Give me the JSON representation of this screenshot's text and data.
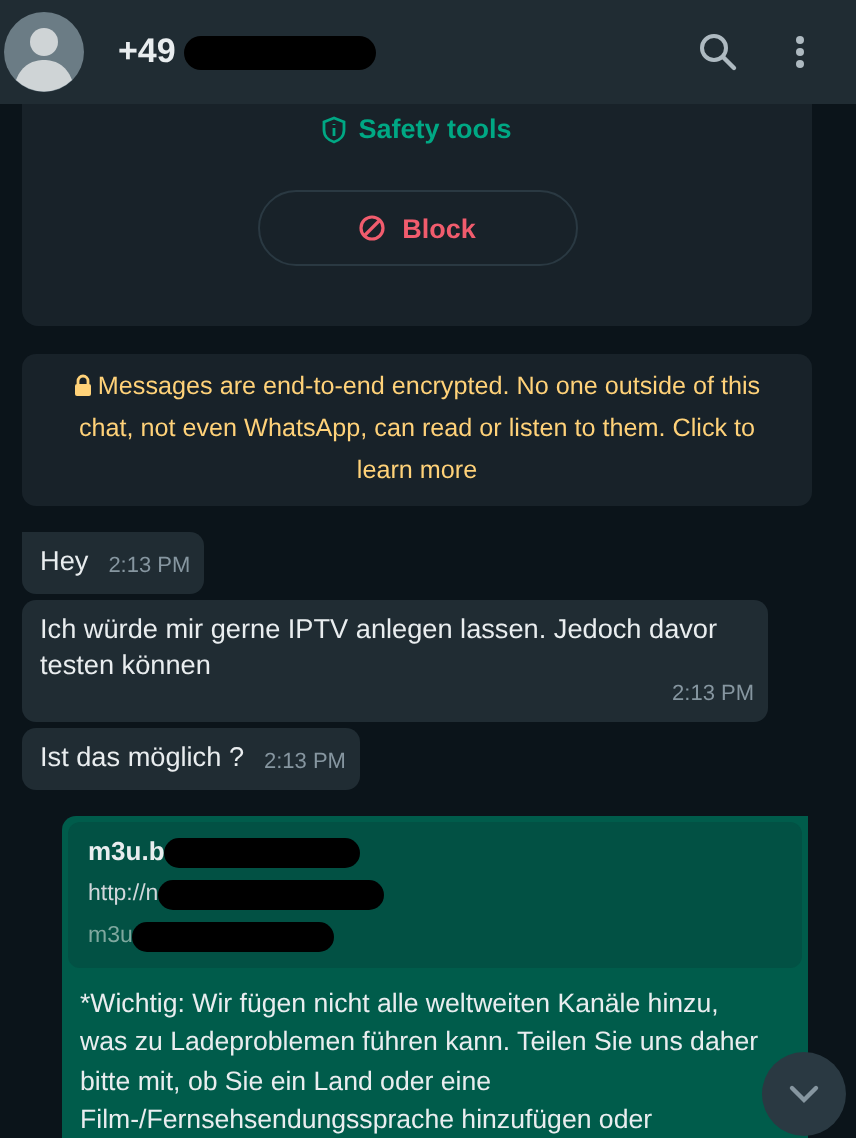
{
  "header": {
    "contact": "+49"
  },
  "safety_card": {
    "safety_tools": "Safety tools",
    "block_button": "Block"
  },
  "encryption_notice": "Messages are end-to-end encrypted. No one outside of this chat, not even WhatsApp, can read or listen to them. Click to learn more",
  "messages": [
    {
      "kind": "incoming",
      "text": "Hey",
      "time": "2:13 PM"
    },
    {
      "kind": "incoming",
      "text": "Ich würde mir gerne IPTV anlegen lassen. Jedoch davor testen können",
      "time": "2:13 PM"
    },
    {
      "kind": "incoming",
      "text": "Ist das möglich ?",
      "time": "2:13 PM"
    },
    {
      "kind": "outgoing",
      "preview": {
        "title": "m3u.b",
        "url": "http://n",
        "site": "m3u"
      },
      "text": "*Wichtig: Wir fügen nicht alle weltweiten Kanäle hinzu, was zu Ladeproblemen führen kann. Teilen Sie uns daher bitte mit, ob Sie ein Land oder eine Film-/Fernsehsendungssprache hinzufügen oder"
    }
  ]
}
